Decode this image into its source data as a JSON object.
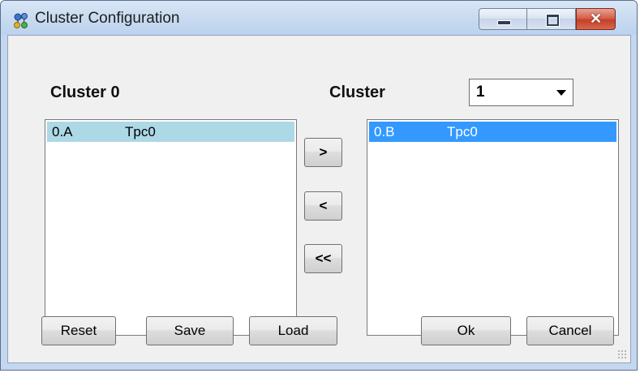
{
  "window": {
    "title": "Cluster Configuration",
    "icon": "cluster-network-icon",
    "controls": {
      "minimize": "minimize-icon",
      "maximize": "maximize-icon",
      "close": "close-icon"
    }
  },
  "left_panel": {
    "heading": "Cluster 0",
    "items": [
      {
        "name": "0.A",
        "value": "Tpc0",
        "selected": true
      }
    ]
  },
  "right_panel": {
    "heading": "Cluster",
    "cluster_select": {
      "value": "1"
    },
    "items": [
      {
        "name": "0.B",
        "value": "Tpc0",
        "selected": true
      }
    ]
  },
  "transfer_buttons": {
    "move_right": ">",
    "move_left": "<",
    "move_all_left": "<<"
  },
  "footer_buttons": {
    "reset": "Reset",
    "save": "Save",
    "load": "Load",
    "ok": "Ok",
    "cancel": "Cancel"
  },
  "colors": {
    "inactive_selection": "#add8e6",
    "active_selection": "#3399ff",
    "title_bar": "#c7daf0",
    "close_button": "#c4402a"
  }
}
